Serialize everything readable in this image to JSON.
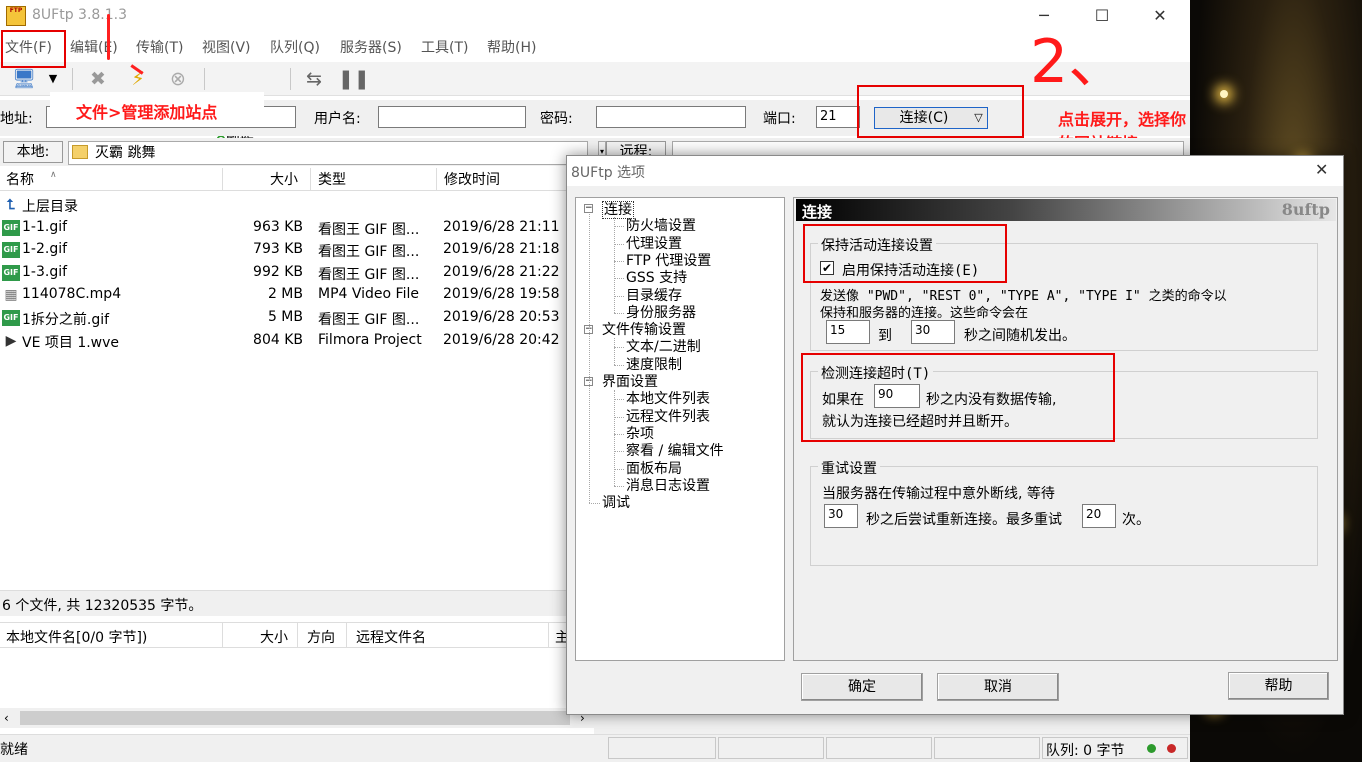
{
  "app": {
    "title": "8UFtp 3.8.1.3",
    "icon_name": "ftp-app-icon"
  },
  "menu": [
    "文件(F)",
    "编辑(E)",
    "传输(T)",
    "视图(V)",
    "队列(Q)",
    "服务器(S)",
    "工具(T)",
    "帮助(H)"
  ],
  "toolbar": {
    "refresh_label": "刷新"
  },
  "connbar": {
    "addr_label": "地址:",
    "user_label": "用户名:",
    "pass_label": "密码:",
    "port_label": "端口:",
    "port_value": "21",
    "connect_label": "连接(C)"
  },
  "annotations": {
    "tip1": "文件>管理添加站点",
    "tip2": "点击展开，选择你的网站链接",
    "step2": "2、"
  },
  "local": {
    "label": "本地:",
    "path": "灭霸 跳舞",
    "columns": [
      "名称",
      "大小",
      "类型",
      "修改时间"
    ],
    "rows": [
      {
        "name": "上层目录",
        "size": "",
        "type": "",
        "date": "",
        "icon": "up-folder-icon"
      },
      {
        "name": "1-1.gif",
        "size": "963 KB",
        "type": "看图王 GIF 图...",
        "date": "2019/6/28 21:11",
        "icon": "gif-file-icon"
      },
      {
        "name": "1-2.gif",
        "size": "793 KB",
        "type": "看图王 GIF 图...",
        "date": "2019/6/28 21:18",
        "icon": "gif-file-icon"
      },
      {
        "name": "1-3.gif",
        "size": "992 KB",
        "type": "看图王 GIF 图...",
        "date": "2019/6/28 21:22",
        "icon": "gif-file-icon"
      },
      {
        "name": "114078C.mp4",
        "size": "2 MB",
        "type": "MP4 Video File",
        "date": "2019/6/28 19:58",
        "icon": "video-file-icon"
      },
      {
        "name": "1拆分之前.gif",
        "size": "5 MB",
        "type": "看图王 GIF 图...",
        "date": "2019/6/28 20:53",
        "icon": "gif-file-icon"
      },
      {
        "name": "VE 项目 1.wve",
        "size": "804 KB",
        "type": "Filmora Project",
        "date": "2019/6/28 20:42",
        "icon": "project-file-icon"
      }
    ],
    "status": "6 个文件, 共 12320535 字节。"
  },
  "queue": {
    "columns": [
      "本地文件名[0/0 字节])",
      "大小",
      "方向",
      "远程文件名",
      "主"
    ]
  },
  "remote": {
    "label": "远程:"
  },
  "status": {
    "left": "就绪",
    "queue": "队列: 0 字节"
  },
  "dialog": {
    "title": "8UFtp 选项",
    "tree": [
      {
        "label": "连接",
        "level": 0,
        "expander": "-"
      },
      {
        "label": "防火墙设置",
        "level": 1
      },
      {
        "label": "代理设置",
        "level": 1
      },
      {
        "label": "FTP 代理设置",
        "level": 1
      },
      {
        "label": "GSS 支持",
        "level": 1
      },
      {
        "label": "目录缓存",
        "level": 1
      },
      {
        "label": "身份服务器",
        "level": 1
      },
      {
        "label": "文件传输设置",
        "level": 0,
        "expander": "-"
      },
      {
        "label": "文本/二进制",
        "level": 1
      },
      {
        "label": "速度限制",
        "level": 1
      },
      {
        "label": "界面设置",
        "level": 0,
        "expander": "-"
      },
      {
        "label": "本地文件列表",
        "level": 1
      },
      {
        "label": "远程文件列表",
        "level": 1
      },
      {
        "label": "杂项",
        "level": 1
      },
      {
        "label": "察看 / 编辑文件",
        "level": 1
      },
      {
        "label": "面板布局",
        "level": 1
      },
      {
        "label": "消息日志设置",
        "level": 1
      },
      {
        "label": "调试",
        "level": 0
      }
    ],
    "panel_title": "连接",
    "panel_brand": "8uftp",
    "keepalive": {
      "group": "保持活动连接设置",
      "checkbox": "启用保持活动连接(E)",
      "checked": true,
      "desc1": "发送像 \"PWD\", \"REST 0\", \"TYPE A\", \"TYPE I\" 之类的命令以",
      "desc2": "保持和服务器的连接。这些命令会在",
      "min": "15",
      "to": "到",
      "max": "30",
      "suffix": "秒之间随机发出。"
    },
    "timeout": {
      "group": "检测连接超时(T)",
      "pre": "如果在",
      "value": "90",
      "post": "秒之内没有数据传输,",
      "line2": "就认为连接已经超时并且断开。"
    },
    "retry": {
      "group": "重试设置",
      "line1": "当服务器在传输过程中意外断线, 等待",
      "delay": "30",
      "mid": "秒之后尝试重新连接。最多重试",
      "count": "20",
      "suffix": "次。"
    },
    "ok": "确定",
    "cancel": "取消",
    "help": "帮助"
  }
}
